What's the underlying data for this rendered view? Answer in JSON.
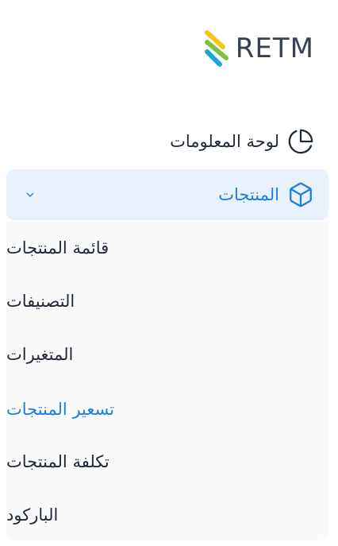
{
  "brand": {
    "name": "RETM",
    "mark_colors": [
      "#f5c518",
      "#7cc242",
      "#1aa7d6"
    ]
  },
  "menu": {
    "dashboard": {
      "label": "لوحة المعلومات",
      "icon": "pie-chart-icon"
    },
    "products": {
      "label": "المنتجات",
      "icon": "cube-icon",
      "expanded": true
    },
    "submenu": [
      {
        "label": "قائمة المنتجات",
        "active": false
      },
      {
        "label": "التصنيفات",
        "active": false
      },
      {
        "label": "المتغيرات",
        "active": false
      },
      {
        "label": "تسعير المنتجات",
        "active": true
      },
      {
        "label": "تكلفة المنتجات",
        "active": false
      },
      {
        "label": "الباركود",
        "active": false
      }
    ]
  },
  "colors": {
    "accent": "#1a7fe0",
    "active_bg": "#e8f1fc",
    "submenu_bg": "#fafafa",
    "text": "#1f2937"
  }
}
